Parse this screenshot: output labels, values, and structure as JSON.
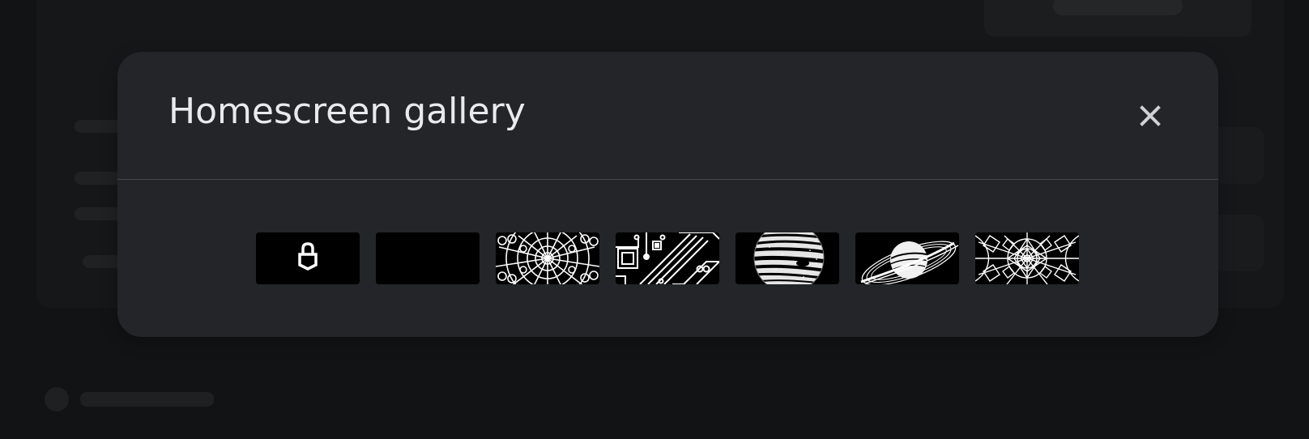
{
  "dialog": {
    "title": "Homescreen gallery",
    "close_icon": "close-icon"
  },
  "gallery": {
    "items": [
      {
        "icon": "lock-icon"
      },
      {
        "icon": "blank-thumbnail"
      },
      {
        "icon": "radial-lace-pattern-icon"
      },
      {
        "icon": "circuit-board-pattern-icon"
      },
      {
        "icon": "jupiter-planet-icon"
      },
      {
        "icon": "saturn-planet-icon"
      },
      {
        "icon": "mandala-pattern-icon"
      }
    ]
  },
  "colors": {
    "background": "#121314",
    "dialog": "#242528",
    "text": "#e8eaed",
    "divider": "#45474b",
    "thumbnail_background": "#000000"
  }
}
